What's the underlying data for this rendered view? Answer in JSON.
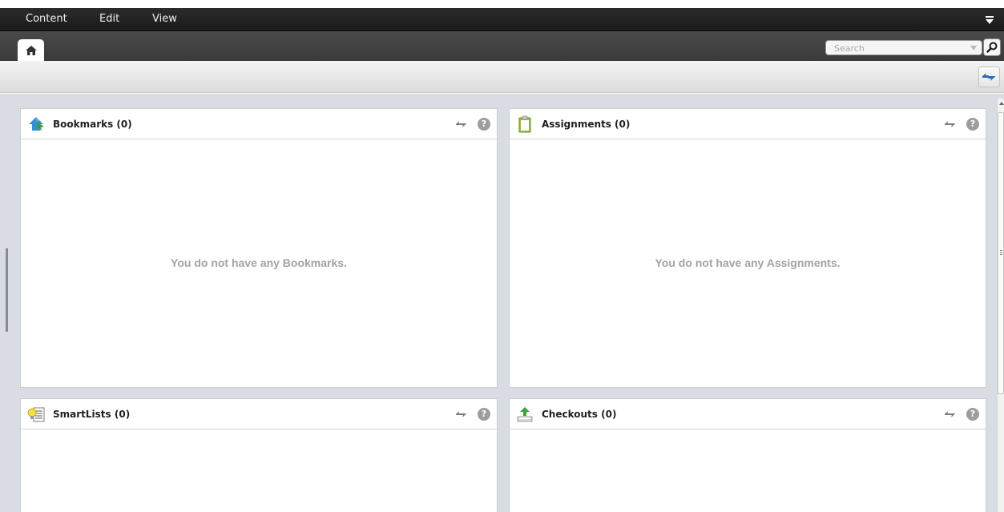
{
  "menu": {
    "items": [
      "Content",
      "Edit",
      "View"
    ]
  },
  "search": {
    "placeholder": "Search"
  },
  "panels": [
    {
      "title": "Bookmarks (0)",
      "empty_message": "You do not have any Bookmarks.",
      "icon": "bookmark-icon"
    },
    {
      "title": "Assignments (0)",
      "empty_message": "You do not have any Assignments.",
      "icon": "clipboard-icon"
    },
    {
      "title": "SmartLists (0)",
      "empty_message": "",
      "icon": "smartlist-icon"
    },
    {
      "title": "Checkouts (0)",
      "empty_message": "",
      "icon": "checkout-icon"
    }
  ],
  "help_label": "?",
  "colors": {
    "menubar": "#222222",
    "tabbar": "#424242",
    "content_bg": "#d9dde3",
    "accent_blue": "#2a6bb8"
  }
}
